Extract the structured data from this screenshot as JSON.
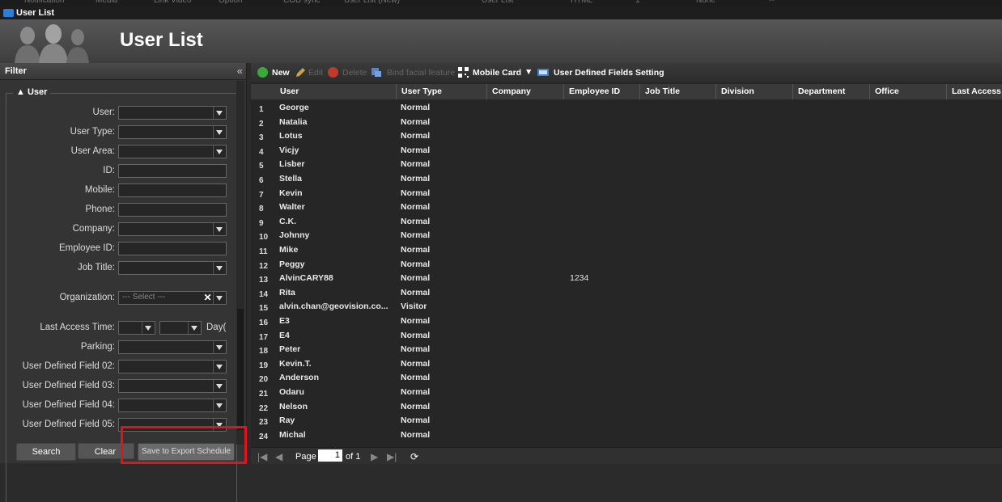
{
  "top_strip": [
    "Notification",
    "Media",
    "Link Video",
    "Option",
    "COD sync",
    "User List (New)",
    "User List",
    "HTML",
    "1",
    "None",
    "--"
  ],
  "window": {
    "title": "User List"
  },
  "banner": {
    "title": "User List"
  },
  "filter": {
    "title": "Filter",
    "collapse_icon": "double-chevron-left",
    "section": "User",
    "fields": [
      {
        "label": "User:",
        "type": "select",
        "value": ""
      },
      {
        "label": "User Type:",
        "type": "select",
        "value": ""
      },
      {
        "label": "User Area:",
        "type": "select",
        "value": ""
      },
      {
        "label": "ID:",
        "type": "text",
        "value": ""
      },
      {
        "label": "Mobile:",
        "type": "text",
        "value": ""
      },
      {
        "label": "Phone:",
        "type": "text",
        "value": ""
      },
      {
        "label": "Company:",
        "type": "select",
        "value": ""
      },
      {
        "label": "Employee ID:",
        "type": "text",
        "value": ""
      },
      {
        "label": "Job Title:",
        "type": "select",
        "value": ""
      }
    ],
    "organization": {
      "label": "Organization:",
      "placeholder": "--- Select ---"
    },
    "last_access": {
      "label": "Last Access Time:",
      "suffix": "Day("
    },
    "fields2": [
      {
        "label": "Parking:"
      },
      {
        "label": "User Defined Field 02:"
      },
      {
        "label": "User Defined Field 03:"
      },
      {
        "label": "User Defined Field 04:"
      },
      {
        "label": "User Defined Field 05:"
      }
    ],
    "buttons": {
      "search": "Search",
      "clear": "Clear",
      "save_export": "Save to Export Schedule"
    }
  },
  "toolbar": {
    "new": "New",
    "edit": "Edit",
    "delete": "Delete",
    "bind": "Bind facial feature",
    "mobile_card": "Mobile Card",
    "udf_setting": "User Defined Fields Setting"
  },
  "grid": {
    "columns": [
      "User",
      "User Type",
      "Company",
      "Employee ID",
      "Job Title",
      "Division",
      "Department",
      "Office",
      "Last Access T"
    ],
    "rows": [
      {
        "n": "1",
        "user": "George",
        "type": "Normal",
        "emp": ""
      },
      {
        "n": "2",
        "user": "Natalia",
        "type": "Normal",
        "emp": ""
      },
      {
        "n": "3",
        "user": "Lotus",
        "type": "Normal",
        "emp": ""
      },
      {
        "n": "4",
        "user": "Vicjy",
        "type": "Normal",
        "emp": ""
      },
      {
        "n": "5",
        "user": "Lisber",
        "type": "Normal",
        "emp": ""
      },
      {
        "n": "6",
        "user": "Stella",
        "type": "Normal",
        "emp": ""
      },
      {
        "n": "7",
        "user": "Kevin",
        "type": "Normal",
        "emp": ""
      },
      {
        "n": "8",
        "user": "Walter",
        "type": "Normal",
        "emp": ""
      },
      {
        "n": "9",
        "user": "C.K.",
        "type": "Normal",
        "emp": ""
      },
      {
        "n": "10",
        "user": "Johnny",
        "type": "Normal",
        "emp": ""
      },
      {
        "n": "11",
        "user": "Mike",
        "type": "Normal",
        "emp": ""
      },
      {
        "n": "12",
        "user": "Peggy",
        "type": "Normal",
        "emp": ""
      },
      {
        "n": "13",
        "user": "AlvinCARY88",
        "type": "Normal",
        "emp": "1234"
      },
      {
        "n": "14",
        "user": "Rita",
        "type": "Normal",
        "emp": ""
      },
      {
        "n": "15",
        "user": "alvin.chan@geovision.co...",
        "type": "Visitor",
        "emp": ""
      },
      {
        "n": "16",
        "user": "E3",
        "type": "Normal",
        "emp": ""
      },
      {
        "n": "17",
        "user": "E4",
        "type": "Normal",
        "emp": ""
      },
      {
        "n": "18",
        "user": "Peter",
        "type": "Normal",
        "emp": ""
      },
      {
        "n": "19",
        "user": "Kevin.T.",
        "type": "Normal",
        "emp": ""
      },
      {
        "n": "20",
        "user": "Anderson",
        "type": "Normal",
        "emp": ""
      },
      {
        "n": "21",
        "user": "Odaru",
        "type": "Normal",
        "emp": ""
      },
      {
        "n": "22",
        "user": "Nelson",
        "type": "Normal",
        "emp": ""
      },
      {
        "n": "23",
        "user": "Ray",
        "type": "Normal",
        "emp": ""
      },
      {
        "n": "24",
        "user": "Michal",
        "type": "Normal",
        "emp": ""
      }
    ]
  },
  "pager": {
    "page_label": "Page",
    "page_value": "1",
    "of_label": "of 1"
  },
  "colors": {
    "accent_new": "#3aa83a",
    "delete": "#c0392b",
    "highlight_box": "#e0141a"
  }
}
